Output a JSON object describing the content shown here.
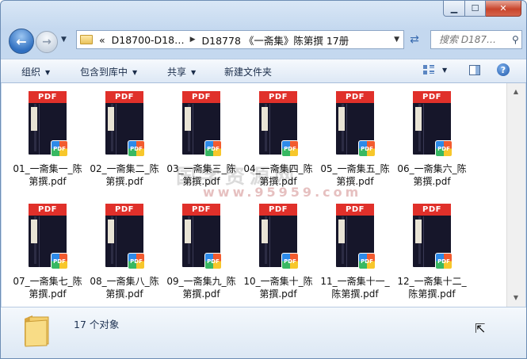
{
  "window": {
    "buttons": {
      "minimize": "▁",
      "maximize": "☐",
      "close": "✕"
    }
  },
  "nav": {
    "breadcrumb": [
      "«",
      "D18700-D18…",
      "D18778 《一斋集》陈第撰 17册"
    ],
    "search_placeholder": "搜索 D187…"
  },
  "toolbar": {
    "organize": "组织",
    "include_in_library": "包含到库中",
    "share": "共享",
    "new_folder": "新建文件夹"
  },
  "files": [
    {
      "name": "01_一斋集一_陈第撰.pdf"
    },
    {
      "name": "02_一斋集二_陈第撰.pdf"
    },
    {
      "name": "03_一斋集三_陈第撰.pdf"
    },
    {
      "name": "04_一斋集四_陈第撰.pdf"
    },
    {
      "name": "05_一斋集五_陈第撰.pdf"
    },
    {
      "name": "06_一斋集六_陈第撰.pdf"
    },
    {
      "name": "07_一斋集七_陈第撰.pdf"
    },
    {
      "name": "08_一斋集八_陈第撰.pdf"
    },
    {
      "name": "09_一斋集九_陈第撰.pdf"
    },
    {
      "name": "10_一斋集十_陈第撰.pdf"
    },
    {
      "name": "11_一斋集十一_陈第撰.pdf"
    },
    {
      "name": "12_一斋集十二_陈第撰.pdf"
    }
  ],
  "thumb": {
    "band": "PDF",
    "badge": "PDF"
  },
  "watermark": {
    "line1": "国学资源网",
    "line2": "www.95959.com"
  },
  "status": {
    "count": "17 个对象"
  },
  "colors": {
    "accent": "#3a6cb0",
    "pdf_red": "#e0302a"
  }
}
